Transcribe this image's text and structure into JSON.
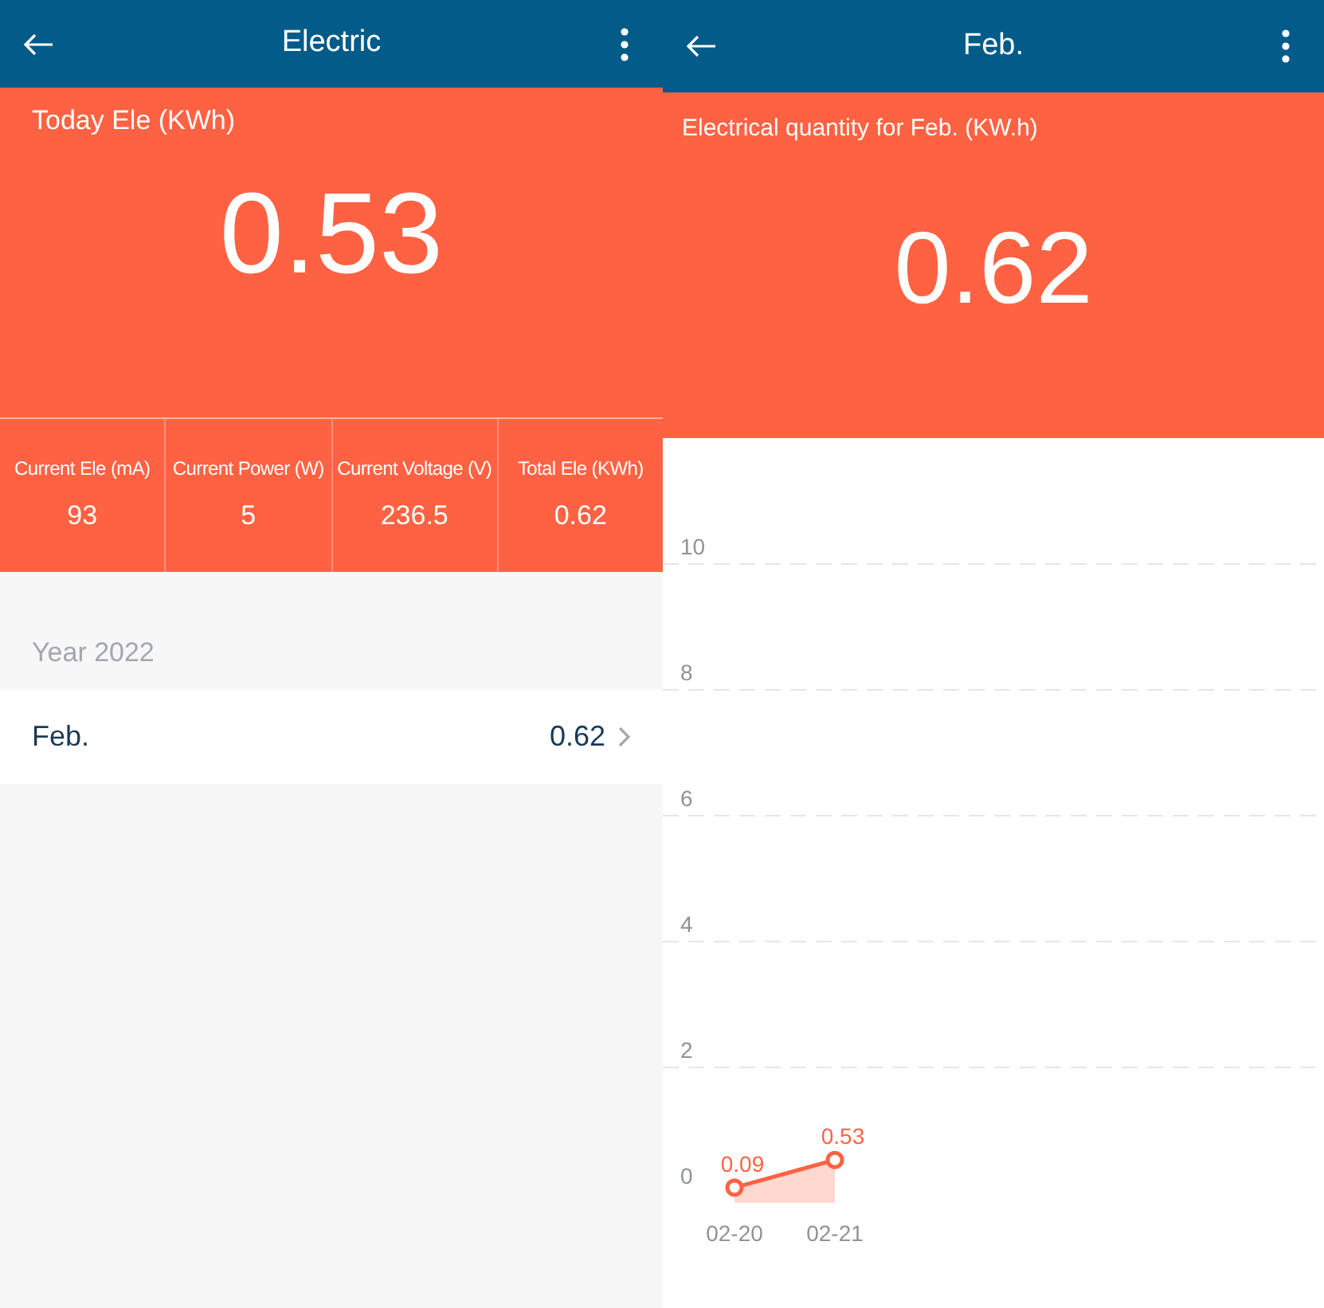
{
  "screens": [
    {
      "header": {
        "title": "Electric"
      },
      "hero": {
        "label": "Today Ele (KWh)",
        "value": "0.53"
      },
      "stats": [
        {
          "label": "Current Ele (mA)",
          "value": "93"
        },
        {
          "label": "Current Power (W)",
          "value": "5"
        },
        {
          "label": "Current Voltage (V)",
          "value": "236.5"
        },
        {
          "label": "Total Ele (KWh)",
          "value": "0.62"
        }
      ],
      "section_title": "Year 2022",
      "rows": [
        {
          "label": "Feb.",
          "value": "0.62"
        }
      ]
    },
    {
      "header": {
        "title": "Feb."
      },
      "hero": {
        "label": "Electrical quantity for Feb. (KW.h)",
        "value": "0.62"
      },
      "chart_data": {
        "type": "area",
        "categories": [
          "02-20",
          "02-21"
        ],
        "series": [
          {
            "color": "#ff6242",
            "values": [
              0.09,
              0.53
            ]
          }
        ],
        "ylim": [
          0,
          10
        ],
        "yticks": [
          0,
          2,
          4,
          6,
          8,
          10
        ],
        "data_labels": true,
        "grid": true
      }
    }
  ]
}
